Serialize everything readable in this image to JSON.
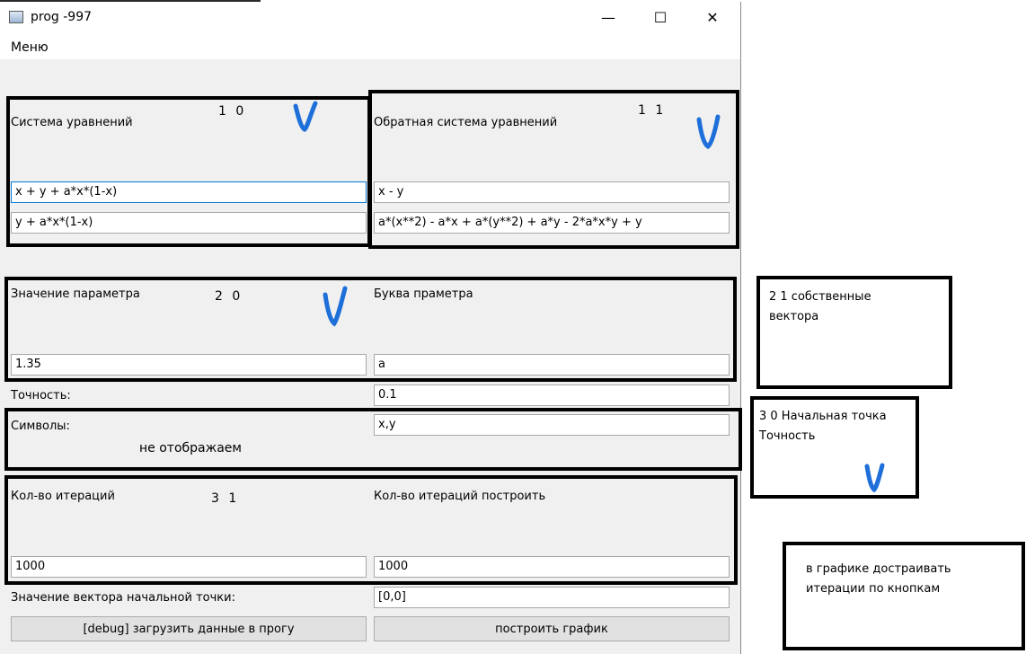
{
  "window": {
    "title": "prog -997",
    "minimize_glyph": "—",
    "maximize_glyph": "☐",
    "close_glyph": "✕"
  },
  "menu": {
    "items": [
      "Меню"
    ]
  },
  "form": {
    "system_label": "Система уравнений",
    "inverse_label": "Обратная система уравнений",
    "system_eq1": "x + y + a*x*(1-x)",
    "system_eq2": "y + a*x*(1-x)",
    "inverse_eq1": "x - y",
    "inverse_eq2": "a*(x**2) - a*x + a*(y**2) + a*y - 2*a*x*y + y",
    "param_value_label": "Значение параметра",
    "param_letter_label": "Буква праметра",
    "param_value": "1.35",
    "param_letter": "a",
    "precision_label": "Точность:",
    "precision_value": "0.1",
    "symbols_label": "Символы:",
    "symbols_value": "x,y",
    "iterations_label": "Кол-во итераций",
    "iterations_plot_label": "Кол-во итераций построить",
    "iterations_value": "1000",
    "iterations_plot_value": "1000",
    "start_vector_label": "Значение вектора начальной точки:",
    "start_vector_value": "[0,0]",
    "load_button": "[debug] загрузить данные в прогу",
    "plot_button": "построить график"
  },
  "annotations": {
    "n10": "1 0",
    "n11": "1 1",
    "n20": "2 0",
    "n31": "3 1",
    "not_displayed": "не отображаем",
    "box21_line1": "2 1 собственные",
    "box21_line2": "вектора",
    "box30_line1": "3 0 Начальная точка",
    "box30_line2": "Точность",
    "graph_line1": "в графике достраивать",
    "graph_line2": "итерации по кнопкам",
    "check_color": "#1e6fd9",
    "box_color": "#000000"
  }
}
